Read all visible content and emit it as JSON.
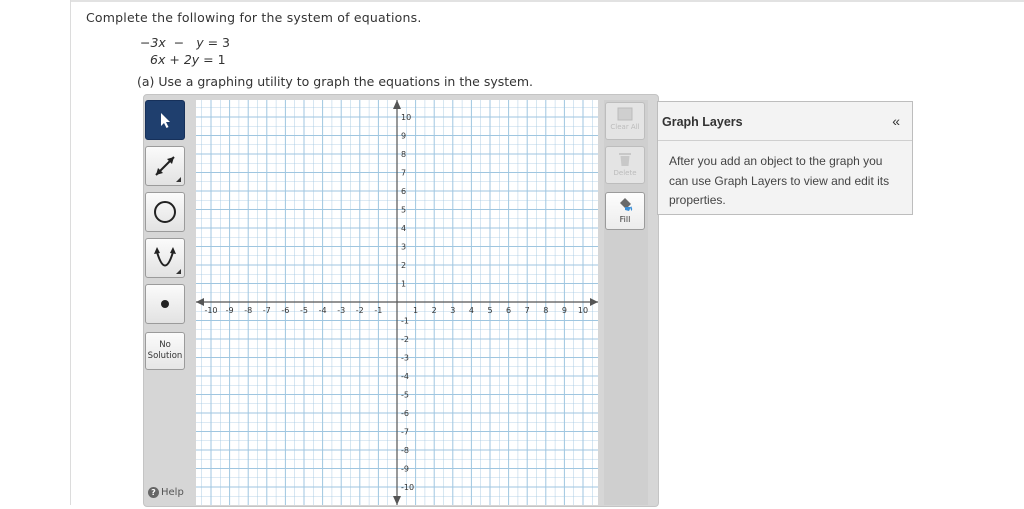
{
  "problem": {
    "prompt": "Complete the following for the system of equations.",
    "equations": [
      {
        "lhs_a": "−3x",
        "op": "−",
        "lhs_b": "y",
        "rhs": "3"
      },
      {
        "lhs_a": "6x",
        "op": "+",
        "lhs_b": "2y",
        "rhs": "1"
      }
    ],
    "part_a": "(a) Use a graphing utility to graph the equations in the system."
  },
  "toolbar": {
    "tools": [
      {
        "icon": "arrow-pointer-icon",
        "active": true
      },
      {
        "icon": "line-segment-icon",
        "active": false
      },
      {
        "icon": "circle-icon",
        "active": false
      },
      {
        "icon": "parabola-icon",
        "active": false
      },
      {
        "icon": "point-icon",
        "active": false
      }
    ],
    "no_solution_line1": "No",
    "no_solution_line2": "Solution",
    "help_label": "Help"
  },
  "right_toolbar": {
    "clear_all": "Clear All",
    "delete": "Delete",
    "fill": "Fill"
  },
  "graph": {
    "x_min": -10,
    "x_max": 10,
    "y_min": -10,
    "y_max": 10,
    "x_ticks": [
      "-10",
      "-9",
      "-8",
      "-7",
      "-6",
      "-5",
      "-4",
      "-3",
      "-2",
      "-1",
      "1",
      "2",
      "3",
      "4",
      "5",
      "6",
      "7",
      "8",
      "9",
      "10"
    ],
    "y_ticks": [
      "10",
      "9",
      "8",
      "7",
      "6",
      "5",
      "4",
      "3",
      "2",
      "1",
      "-1",
      "-2",
      "-3",
      "-4",
      "-5",
      "-6",
      "-7",
      "-8",
      "-9",
      "-10"
    ],
    "grid_color": "#9fc6e0",
    "axis_color": "#555555"
  },
  "layers": {
    "title": "Graph Layers",
    "collapse_glyph": "«",
    "body": "After you add an object to the graph you can use Graph Layers to view and edit its properties."
  }
}
